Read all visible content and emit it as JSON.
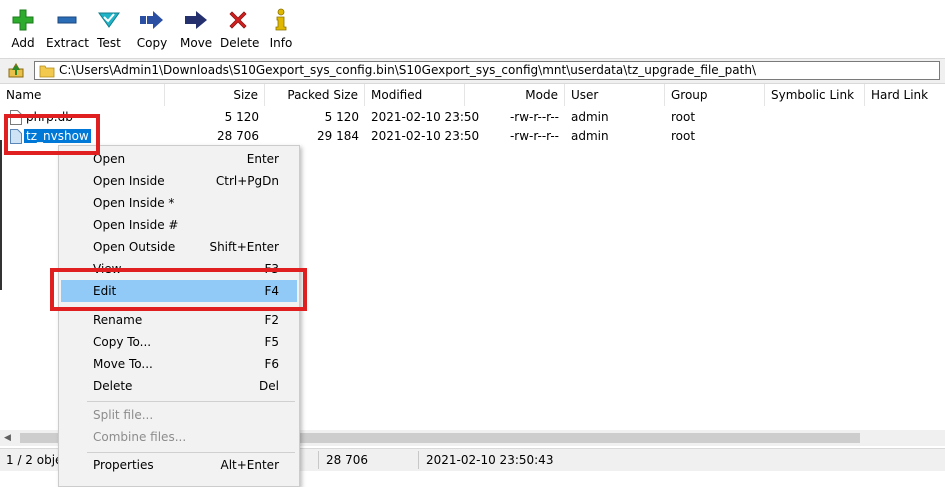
{
  "toolbar": {
    "buttons": [
      {
        "label": "Add",
        "icon": "plus-icon",
        "color": "#2dab2d"
      },
      {
        "label": "Extract",
        "icon": "minus-icon",
        "color": "#2b6cb6"
      },
      {
        "label": "Test",
        "icon": "checkmark-icon",
        "color": "#1fb4c8"
      },
      {
        "label": "Copy",
        "icon": "double-arrow-icon",
        "color": "#2b4fa3"
      },
      {
        "label": "Move",
        "icon": "arrow-right-icon",
        "color": "#25306e"
      },
      {
        "label": "Delete",
        "icon": "x-icon",
        "color": "#d42020"
      },
      {
        "label": "Info",
        "icon": "info-icon",
        "color": "#e0b800"
      }
    ]
  },
  "address": {
    "path": "C:\\Users\\Admin1\\Downloads\\S10Gexport_sys_config.bin\\S10Gexport_sys_config\\mnt\\userdata\\tz_upgrade_file_path\\"
  },
  "columns": [
    "Name",
    "Size",
    "Packed Size",
    "Modified",
    "Mode",
    "User",
    "Group",
    "Symbolic Link",
    "Hard Link"
  ],
  "rows": [
    {
      "name": "phrp.db",
      "size": "5 120",
      "packed": "5 120",
      "modified": "2021-02-10 23:50",
      "mode": "-rw-r--r--",
      "user": "admin",
      "group": "root",
      "symlink": "",
      "hardlink": ""
    },
    {
      "name": "tz_nvshow",
      "size": "28 706",
      "packed": "29 184",
      "modified": "2021-02-10 23:50",
      "mode": "-rw-r--r--",
      "user": "admin",
      "group": "root",
      "symlink": "",
      "hardlink": ""
    }
  ],
  "context_menu": {
    "items": [
      {
        "label": "Open",
        "shortcut": "Enter"
      },
      {
        "label": "Open Inside",
        "shortcut": "Ctrl+PgDn"
      },
      {
        "label": "Open Inside *",
        "shortcut": ""
      },
      {
        "label": "Open Inside #",
        "shortcut": ""
      },
      {
        "label": "Open Outside",
        "shortcut": "Shift+Enter"
      },
      {
        "label": "View",
        "shortcut": "F3"
      },
      {
        "label": "Edit",
        "shortcut": "F4"
      },
      {
        "label": "Rename",
        "shortcut": "F2"
      },
      {
        "label": "Copy To...",
        "shortcut": "F5"
      },
      {
        "label": "Move To...",
        "shortcut": "F6"
      },
      {
        "label": "Delete",
        "shortcut": "Del"
      },
      {
        "label": "Split file...",
        "shortcut": ""
      },
      {
        "label": "Combine files...",
        "shortcut": ""
      },
      {
        "label": "Properties",
        "shortcut": "Alt+Enter"
      }
    ]
  },
  "status": {
    "selection": "1 / 2 objec",
    "size": "28 706",
    "modified": "2021-02-10 23:50:43"
  },
  "colors": {
    "selection": "#0078d7",
    "menu_highlight": "#91c9f7",
    "annotation": "#e02020"
  }
}
